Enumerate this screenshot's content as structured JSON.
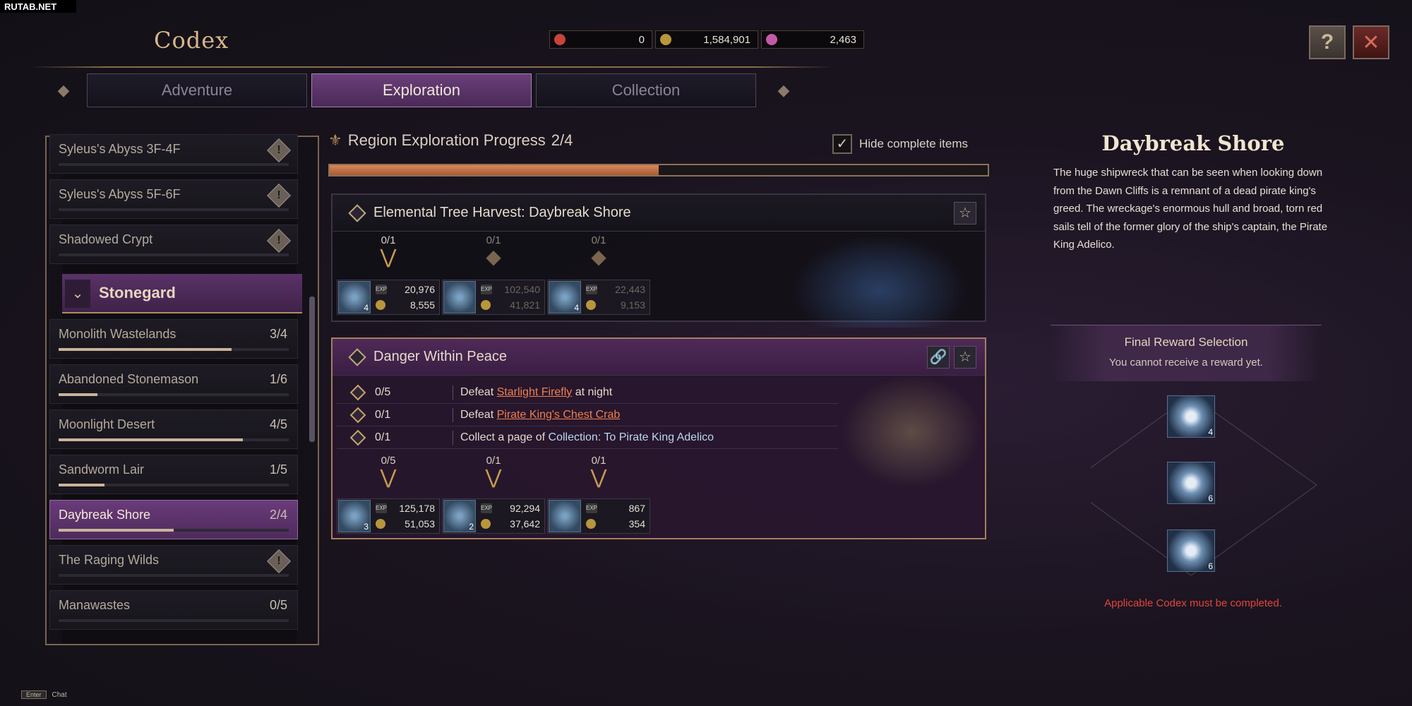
{
  "watermark": "RUTAB.NET",
  "app": {
    "title": "Codex"
  },
  "currencies": [
    {
      "icon": "red-ticket-icon",
      "value": "0",
      "color": "#c8433b"
    },
    {
      "icon": "gold-coin-icon",
      "value": "1,584,901",
      "color": "#b8963c"
    },
    {
      "icon": "pink-gem-icon",
      "value": "2,463",
      "color": "#c45aa6"
    }
  ],
  "top_buttons": {
    "help": "?",
    "close": "✕"
  },
  "tabs": [
    {
      "label": "Adventure",
      "active": false
    },
    {
      "label": "Exploration",
      "active": true
    },
    {
      "label": "Collection",
      "active": false
    }
  ],
  "sidebar": {
    "items_top": [
      {
        "label": "Syleus's Abyss 3F-4F",
        "warn": true
      },
      {
        "label": "Syleus's Abyss 5F-6F",
        "warn": true
      },
      {
        "label": "Shadowed Crypt",
        "warn": true
      }
    ],
    "group": {
      "label": "Stonegard",
      "chevron": "❯"
    },
    "items": [
      {
        "label": "Monolith Wastelands",
        "count": "3/4",
        "progress": 0.75
      },
      {
        "label": "Abandoned Stonemason",
        "count": "1/6",
        "progress": 0.17
      },
      {
        "label": "Moonlight Desert",
        "count": "4/5",
        "progress": 0.8
      },
      {
        "label": "Sandworm Lair",
        "count": "1/5",
        "progress": 0.2
      },
      {
        "label": "Daybreak Shore",
        "count": "2/4",
        "progress": 0.5,
        "active": true
      },
      {
        "label": "The Raging Wilds",
        "warn": true
      },
      {
        "label": "Manawastes",
        "count": "0/5",
        "progress": 0
      }
    ]
  },
  "region": {
    "title": "Region Exploration Progress",
    "progress_text": "2/4",
    "progress": 0.5,
    "hide_complete_label": "Hide complete items",
    "hide_complete_checked": true
  },
  "cards": [
    {
      "title": "Elemental Tree Harvest: Daybreak Shore",
      "rewards": [
        {
          "count": "0/1",
          "qty": "4",
          "exp": "20,976",
          "gold": "8,555",
          "dim": false
        },
        {
          "count": "0/1",
          "qty": "",
          "exp": "102,540",
          "gold": "41,821",
          "dim": true
        },
        {
          "count": "0/1",
          "qty": "4",
          "exp": "22,443",
          "gold": "9,153",
          "dim": true
        }
      ]
    },
    {
      "title": "Danger Within Peace",
      "tasks": [
        {
          "count": "0/5",
          "prefix": "Defeat ",
          "target": "Starlight Firefly",
          "suffix": " at night"
        },
        {
          "count": "0/1",
          "prefix": "Defeat ",
          "target": "Pirate King's Chest Crab",
          "suffix": ""
        },
        {
          "count": "0/1",
          "prefix": "Collect a page of ",
          "target": "Collection: To Pirate King Adelico",
          "suffix": ""
        }
      ],
      "rewards": [
        {
          "count": "0/5",
          "qty": "3",
          "exp": "125,178",
          "gold": "51,053"
        },
        {
          "count": "0/1",
          "qty": "2",
          "exp": "92,294",
          "gold": "37,642"
        },
        {
          "count": "0/1",
          "qty": "",
          "exp": "867",
          "gold": "354"
        }
      ]
    }
  ],
  "info": {
    "title": "Daybreak Shore",
    "description": "The huge shipwreck that can be seen when looking down from the Dawn Cliffs is a remnant of a dead pirate king's greed. The wreckage's enormous hull and broad, torn red sails tell of the former glory of the ship's captain, the Pirate King Adelico."
  },
  "final_reward": {
    "title": "Final Reward Selection",
    "subtitle": "You cannot receive a reward yet.",
    "slots": [
      {
        "qty": "4"
      },
      {
        "qty": "6"
      },
      {
        "qty": "6"
      }
    ],
    "warning": "Applicable Codex must be completed."
  },
  "chat": {
    "key": "Enter",
    "label": "Chat"
  },
  "icons": {
    "exp_tag": "EXP"
  }
}
